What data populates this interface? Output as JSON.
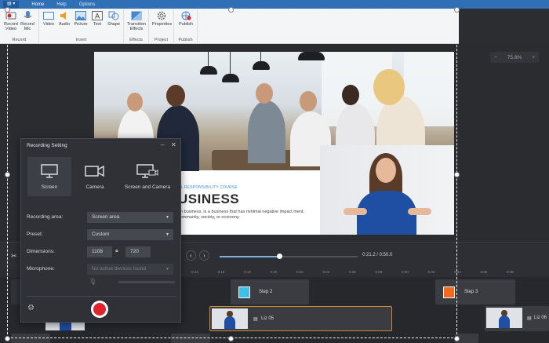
{
  "ribbon": {
    "file_label": "",
    "tabs": [
      "Home",
      "Help",
      "Options"
    ],
    "groups": {
      "record": {
        "label": "Record",
        "buttons": [
          "Record Video",
          "Record Mic"
        ]
      },
      "insert": {
        "label": "Insert",
        "buttons": [
          "Video",
          "Audio",
          "Picture",
          "Text",
          "Shape"
        ]
      },
      "effects": {
        "label": "Effects",
        "buttons": [
          "Transition Effects"
        ]
      },
      "project": {
        "label": "Project",
        "buttons": [
          "Properties"
        ]
      },
      "publish": {
        "label": "Publish",
        "buttons": [
          "Publish"
        ]
      }
    }
  },
  "canvas": {
    "zoom_minus": "−",
    "zoom_value": "75.8%",
    "zoom_plus": "+"
  },
  "slide": {
    "subtitle": "AL RESPONSIBILITY COURSE",
    "title": "USINESS",
    "body": "en business, is a business that has minimal negative impact ment, community, society, or economy."
  },
  "playback": {
    "time": "0:21.2 / 0:50.0",
    "progress": 0.43
  },
  "timeline": {
    "ticks": [
      "0:14",
      "0:16",
      "0:18",
      "0:20",
      "0:22",
      "0:24",
      "0:26",
      "0:28",
      "0:30",
      "0:32",
      "0:34",
      "0:36",
      "0:38"
    ],
    "clips": [
      {
        "label": "Step 2",
        "color": "#3fc0ea"
      },
      {
        "label": "Step 3",
        "color": "#f26b1d"
      },
      {
        "label": "Liz 05"
      },
      {
        "label": "Liz 06"
      }
    ]
  },
  "recording_dialog": {
    "title": "Recording Setting",
    "modes": [
      "Screen",
      "Camera",
      "Screen and Camera"
    ],
    "active_mode": "Screen",
    "fields": {
      "recording_area": {
        "label": "Recording area:",
        "value": "Screen area"
      },
      "preset": {
        "label": "Preset:",
        "value": "Custom"
      },
      "dimensions": {
        "label": "Dimensions:",
        "width": "1108",
        "height": "720"
      },
      "microphone": {
        "label": "Microphone:",
        "value": "No active devices found"
      }
    }
  },
  "colors": {
    "accent": "#2f6fb6",
    "record": "#e0242e",
    "panel": "#2f3136"
  }
}
